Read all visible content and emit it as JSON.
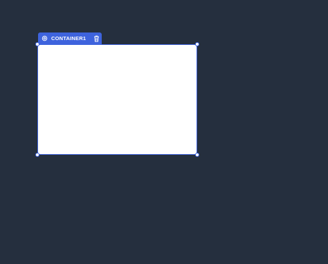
{
  "component": {
    "name": "CONTAINER1",
    "settings_icon": "gear-icon",
    "delete_icon": "trash-icon"
  },
  "colors": {
    "canvas_bg": "#252f3e",
    "accent": "#3e63dd",
    "container_bg": "#ffffff"
  }
}
